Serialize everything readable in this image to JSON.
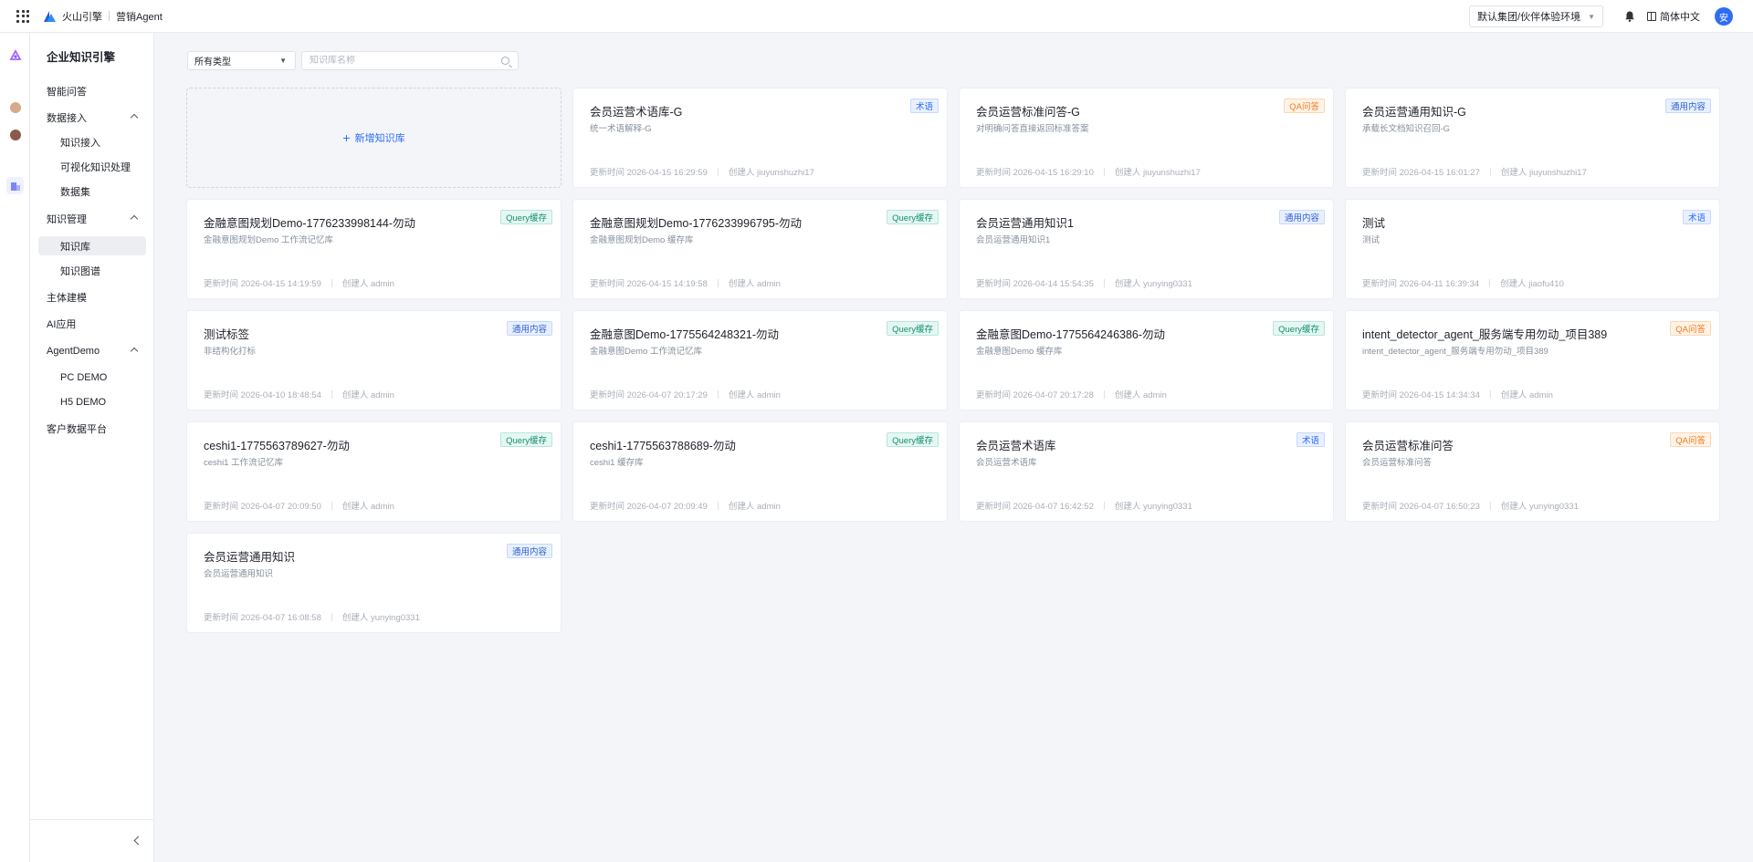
{
  "topbar": {
    "brand": "火山引擎",
    "product": "营销Agent",
    "env_select": "默认集团/伙伴体验环境",
    "language": "简体中文",
    "avatar_text": "安"
  },
  "sidebar": {
    "title": "企业知识引擎",
    "items": [
      {
        "label": "智能问答"
      },
      {
        "label": "数据接入"
      },
      {
        "label": "知识接入"
      },
      {
        "label": "可视化知识处理"
      },
      {
        "label": "数据集"
      },
      {
        "label": "知识管理"
      },
      {
        "label": "知识库"
      },
      {
        "label": "知识图谱"
      },
      {
        "label": "主体建模"
      },
      {
        "label": "AI应用"
      },
      {
        "label": "AgentDemo"
      },
      {
        "label": "PC DEMO"
      },
      {
        "label": "H5 DEMO"
      },
      {
        "label": "客户数据平台"
      }
    ]
  },
  "filters": {
    "type_select": "所有类型",
    "search_placeholder": "知识库名称"
  },
  "add_card": {
    "label": "新增知识库"
  },
  "tag_colors": {
    "term": "#2f6df6",
    "qa": "#f57a16",
    "general": "#2f5fcf",
    "query": "#14906f"
  },
  "cards": [
    {
      "title": "会员运营术语库-G",
      "desc": "统一术语解释-G",
      "updated": "更新时间 2026-04-15 16:29:59",
      "creator": "创建人 jiuyunshuzhi17",
      "tag": "术语"
    },
    {
      "title": "会员运营标准问答-G",
      "desc": "对明确问答直接返回标准答案",
      "updated": "更新时间 2026-04-15 16:29:10",
      "creator": "创建人 jiuyunshuzhi17",
      "tag": "QA问答"
    },
    {
      "title": "会员运营通用知识-G",
      "desc": "承载长文档知识召回-G",
      "updated": "更新时间 2026-04-15 16:01:27",
      "creator": "创建人 jiuyunshuzhi17",
      "tag": "通用内容"
    },
    {
      "title": "金融意图规划Demo-1776233998144-勿动",
      "desc": "金融意图规划Demo 工作流记忆库",
      "updated": "更新时间 2026-04-15 14:19:59",
      "creator": "创建人 admin",
      "tag": "Query缓存"
    },
    {
      "title": "金融意图规划Demo-1776233996795-勿动",
      "desc": "金融意图规划Demo 缓存库",
      "updated": "更新时间 2026-04-15 14:19:58",
      "creator": "创建人 admin",
      "tag": "Query缓存"
    },
    {
      "title": "会员运营通用知识1",
      "desc": "会员运营通用知识1",
      "updated": "更新时间 2026-04-14 15:54:35",
      "creator": "创建人 yunying0331",
      "tag": "通用内容"
    },
    {
      "title": "测试",
      "desc": "测试",
      "updated": "更新时间 2026-04-11 16:39:34",
      "creator": "创建人 jiaofu410",
      "tag": "术语"
    },
    {
      "title": "测试标签",
      "desc": "非结构化打标",
      "updated": "更新时间 2026-04-10 18:48:54",
      "creator": "创建人 admin",
      "tag": "通用内容"
    },
    {
      "title": "金融意图Demo-1775564248321-勿动",
      "desc": "金融意图Demo 工作流记忆库",
      "updated": "更新时间 2026-04-07 20:17:29",
      "creator": "创建人 admin",
      "tag": "Query缓存"
    },
    {
      "title": "金融意图Demo-1775564246386-勿动",
      "desc": "金融意图Demo 缓存库",
      "updated": "更新时间 2026-04-07 20:17:28",
      "creator": "创建人 admin",
      "tag": "Query缓存"
    },
    {
      "title": "intent_detector_agent_服务端专用勿动_项目389",
      "desc": "intent_detector_agent_服务端专用勿动_项目389",
      "updated": "更新时间 2026-04-15 14:34:34",
      "creator": "创建人 admin",
      "tag": "QA问答"
    },
    {
      "title": "ceshi1-1775563789627-勿动",
      "desc": "ceshi1 工作流记忆库",
      "updated": "更新时间 2026-04-07 20:09:50",
      "creator": "创建人 admin",
      "tag": "Query缓存"
    },
    {
      "title": "ceshi1-1775563788689-勿动",
      "desc": "ceshi1 缓存库",
      "updated": "更新时间 2026-04-07 20:09:49",
      "creator": "创建人 admin",
      "tag": "Query缓存"
    },
    {
      "title": "会员运营术语库",
      "desc": "会员运营术语库",
      "updated": "更新时间 2026-04-07 16:42:52",
      "creator": "创建人 yunying0331",
      "tag": "术语"
    },
    {
      "title": "会员运营标准问答",
      "desc": "会员运营标准问答",
      "updated": "更新时间 2026-04-07 16:50:23",
      "creator": "创建人 yunying0331",
      "tag": "QA问答"
    },
    {
      "title": "会员运营通用知识",
      "desc": "会员运营通用知识",
      "updated": "更新时间 2026-04-07 16:08:58",
      "creator": "创建人 yunying0331",
      "tag": "通用内容"
    }
  ]
}
